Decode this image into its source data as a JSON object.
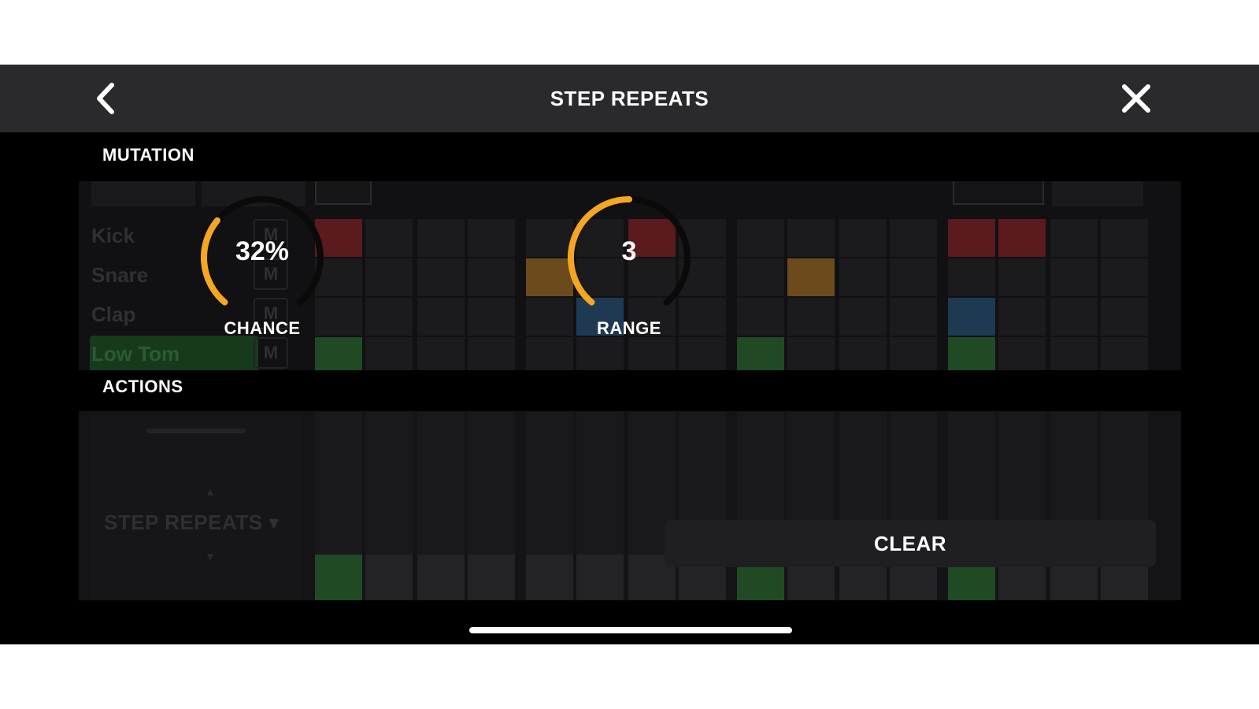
{
  "header": {
    "title": "STEP REPEATS",
    "back_icon": "chevron-left-icon",
    "close_icon": "close-icon"
  },
  "mutation": {
    "section_label": "MUTATION",
    "chance": {
      "value_text": "32%",
      "label": "CHANCE",
      "fraction": 0.32
    },
    "range": {
      "value_text": "3",
      "label": "RANGE",
      "fraction": 0.5
    },
    "accent_color": "#f5a623"
  },
  "actions": {
    "section_label": "ACTIONS",
    "clear_label": "CLEAR"
  },
  "background_sequencer": {
    "tracks": [
      "Kick",
      "Snare",
      "Clap",
      "Low Tom"
    ],
    "mute_label": "M",
    "lane_selector_label": "STEP REPEATS ▾",
    "colors": {
      "kick": "#5a1a1e",
      "snare": "#6b4a1c",
      "clap": "#1e3a52",
      "low_tom": "#1f4a24"
    }
  }
}
